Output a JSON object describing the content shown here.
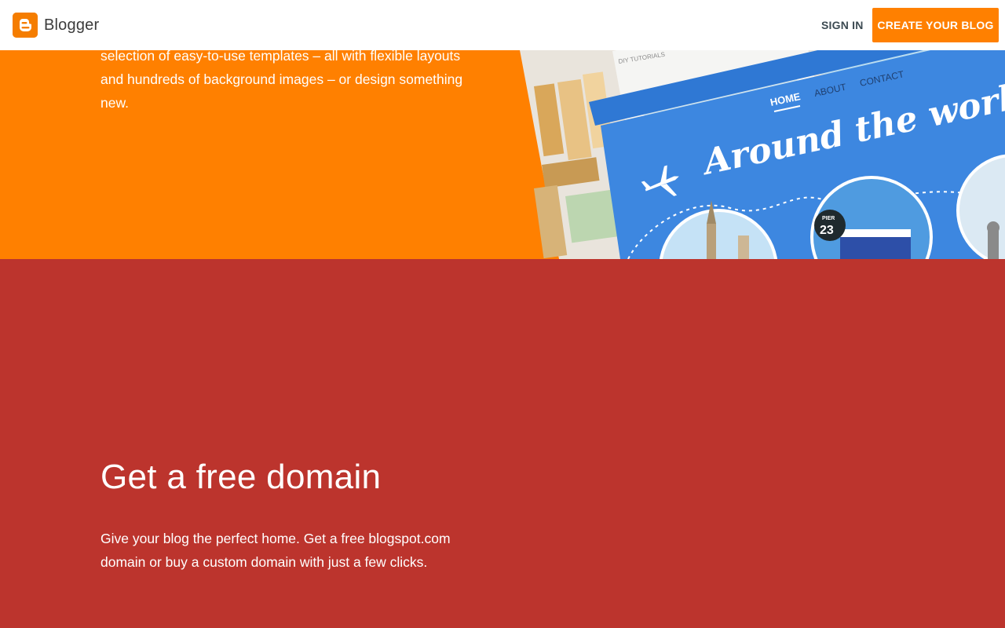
{
  "header": {
    "brand": "Blogger",
    "signin_label": "SIGN IN",
    "create_label": "CREATE YOUR BLOG"
  },
  "templates_section": {
    "body": "selection of easy-to-use templates – all with flexible layouts and hundreds of background images – or design something new."
  },
  "illustration": {
    "diy_label": "DIY TUTORIALS",
    "nav": [
      "HOME",
      "ABOUT",
      "CONTACT"
    ],
    "headline": "Around the world",
    "pier_label": "PIER",
    "pier_number": "23"
  },
  "domain_section": {
    "title": "Get a free domain",
    "body": "Give your blog the perfect home. Get a free blogspot.com domain or buy a custom domain with just a few clicks."
  },
  "colors": {
    "orange": "#ff8000",
    "red": "#bc342d",
    "blue": "#3d87e0"
  }
}
